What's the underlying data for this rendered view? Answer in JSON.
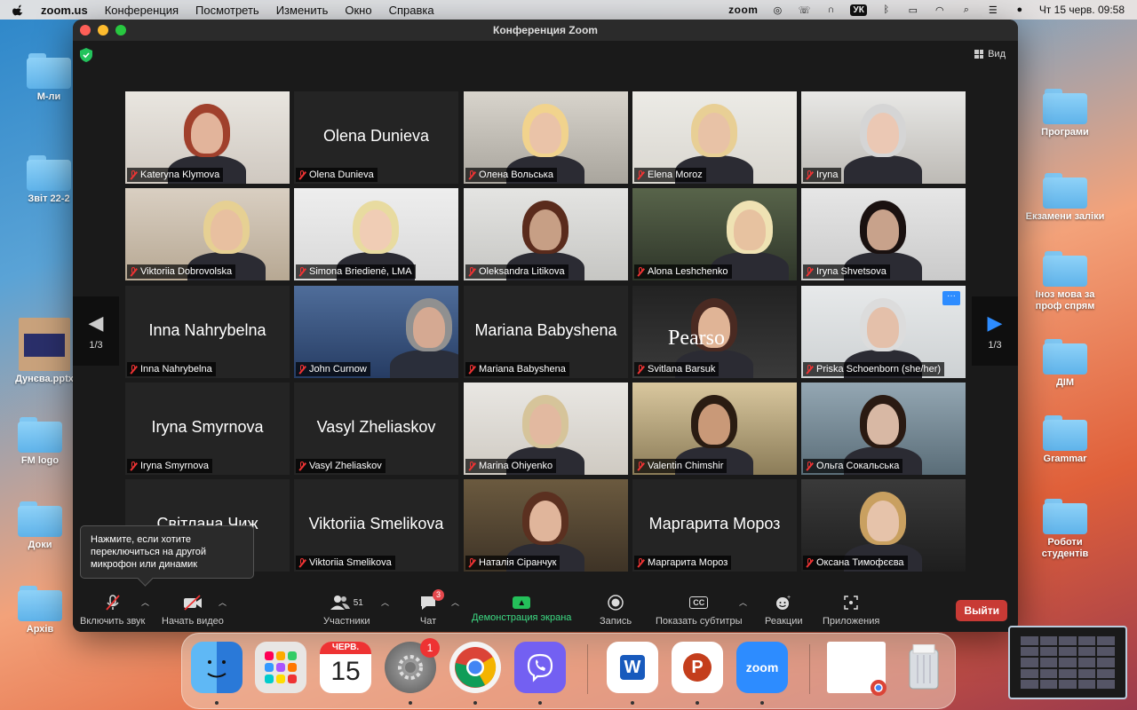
{
  "menubar": {
    "app": "zoom.us",
    "items": [
      "Конференция",
      "Посмотреть",
      "Изменить",
      "Окно",
      "Справка"
    ],
    "status_zoom": "zoom",
    "keyboard": "УК",
    "datetime": "Чт 15 черв.  09:58"
  },
  "desktop": {
    "left_icons": [
      {
        "label": "М-ли"
      },
      {
        "label": "Звіт 22-2"
      },
      {
        "label": "Дунєва.pptx"
      },
      {
        "label": "FM logo"
      },
      {
        "label": "Доки"
      },
      {
        "label": "Архів"
      }
    ],
    "right_icons": [
      {
        "label": "Програми"
      },
      {
        "label": "Екзамени заліки"
      },
      {
        "label": "Іноз мова за проф спрям"
      },
      {
        "label": "ДІМ"
      },
      {
        "label": "Grammar"
      },
      {
        "label": "Роботи студентів"
      }
    ]
  },
  "window": {
    "title": "Конференция Zoom",
    "view_label": "Вид",
    "page_left": "1/3",
    "page_right": "1/3"
  },
  "tiles": [
    {
      "name": "Kateryna Klymova",
      "big": "",
      "video": true
    },
    {
      "name": "Olena Dunieva",
      "big": "Olena Dunieva",
      "video": false
    },
    {
      "name": "Олена Вольська",
      "big": "",
      "video": true
    },
    {
      "name": "Elena Moroz",
      "big": "",
      "video": true
    },
    {
      "name": "Iryna",
      "big": "",
      "video": true
    },
    {
      "name": "Viktoriia Dobrovolska",
      "big": "",
      "video": true
    },
    {
      "name": "Simona Briedienė, LMA",
      "big": "",
      "video": true
    },
    {
      "name": "Oleksandra Litikova",
      "big": "",
      "video": true
    },
    {
      "name": "Alona Leshchenko",
      "big": "",
      "video": true
    },
    {
      "name": "Iryna Shvetsova",
      "big": "",
      "video": true
    },
    {
      "name": "Inna Nahrybelna",
      "big": "Inna Nahrybelna",
      "video": false
    },
    {
      "name": "John Curnow",
      "big": "",
      "video": true
    },
    {
      "name": "Mariana Babyshena",
      "big": "Mariana Babyshena",
      "video": false
    },
    {
      "name": "Svitlana Barsuk",
      "big": "",
      "video": true
    },
    {
      "name": "Priska Schoenborn (she/her)",
      "big": "",
      "video": true
    },
    {
      "name": "Iryna Smyrnova",
      "big": "Iryna Smyrnova",
      "video": false
    },
    {
      "name": "Vasyl Zheliaskov",
      "big": "Vasyl Zheliaskov",
      "video": false
    },
    {
      "name": "Marina Ohiyenko",
      "big": "",
      "video": true
    },
    {
      "name": "Valentin Chimshir",
      "big": "",
      "video": true
    },
    {
      "name": "Ольга Сокальська",
      "big": "",
      "video": true
    },
    {
      "name": "",
      "big": "Світлана Чиж",
      "video": false
    },
    {
      "name": "Viktoriia Smelikova",
      "big": "Viktoriia Smelikova",
      "video": false
    },
    {
      "name": "Наталія Сіранчук",
      "big": "",
      "video": true
    },
    {
      "name": "Маргарита Мороз",
      "big": "Маргарита Мороз",
      "video": false
    },
    {
      "name": "Оксана Тимофєєва",
      "big": "",
      "video": true
    }
  ],
  "tile_extras": {
    "pearson_text": "Pearso"
  },
  "tooltip": "Нажмите, если хотите переключиться на другой микрофон или динамик",
  "toolbar": {
    "mute": "Включить звук",
    "video": "Начать видео",
    "participants": "Участники",
    "participants_count": "51",
    "chat": "Чат",
    "chat_badge": "3",
    "share": "Демонстрация экрана",
    "record": "Запись",
    "captions": "Показать субтитры",
    "captions_icon": "CC",
    "reactions": "Реакции",
    "apps": "Приложения",
    "leave": "Выйти"
  },
  "dock": {
    "calendar_month": "ЧЕРВ.",
    "calendar_day": "15",
    "settings_badge": "1",
    "word_letter": "W",
    "ppt_letter": "P",
    "zoom_text": "zoom"
  }
}
